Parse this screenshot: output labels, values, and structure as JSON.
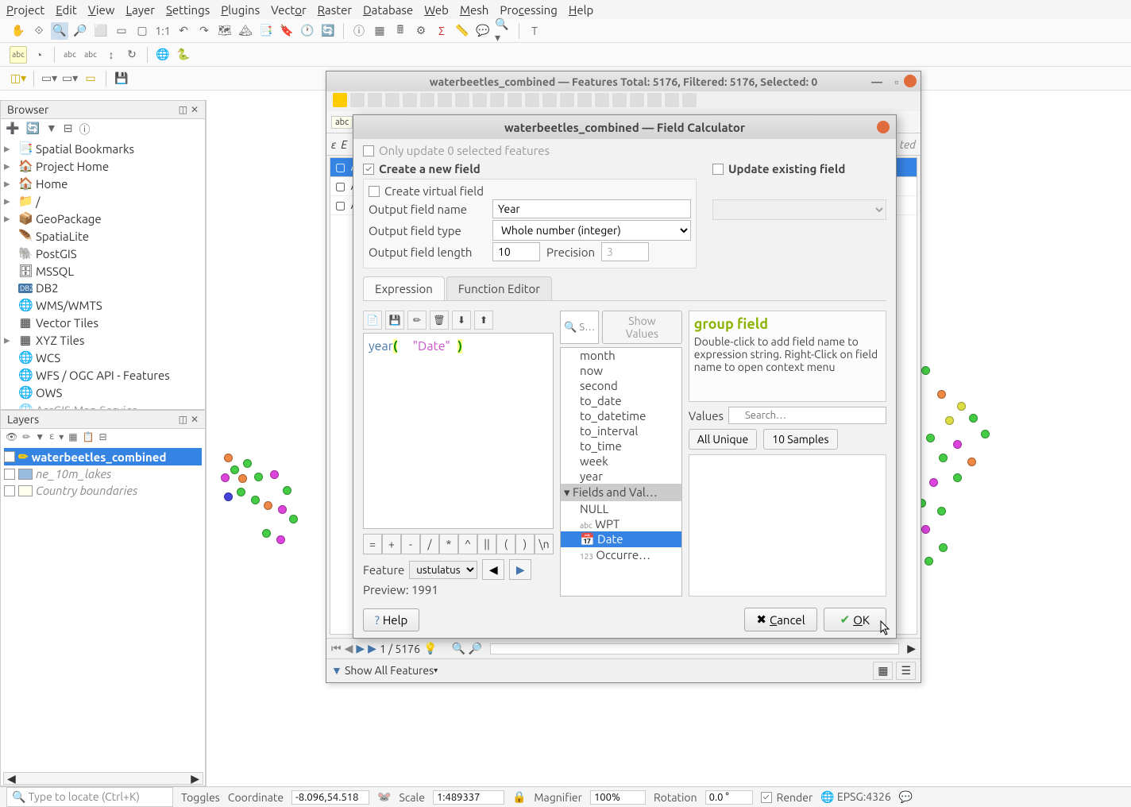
{
  "menubar": [
    "Project",
    "Edit",
    "View",
    "Layer",
    "Settings",
    "Plugins",
    "Vector",
    "Raster",
    "Database",
    "Web",
    "Mesh",
    "Processing",
    "Help"
  ],
  "browser": {
    "title": "Browser",
    "items": [
      "Spatial Bookmarks",
      "Project Home",
      "Home",
      "/",
      "GeoPackage",
      "SpatiaLite",
      "PostGIS",
      "MSSQL",
      "DB2",
      "WMS/WMTS",
      "Vector Tiles",
      "XYZ Tiles",
      "WCS",
      "WFS / OGC API - Features",
      "OWS",
      "ArcGIS Map Service"
    ]
  },
  "layers": {
    "title": "Layers",
    "items": [
      {
        "name": "waterbeetles_combined",
        "checked": true,
        "selected": true,
        "italic": false,
        "color": "#fc0"
      },
      {
        "name": "ne_10m_lakes",
        "checked": false,
        "selected": false,
        "italic": true,
        "color": "#9bd"
      },
      {
        "name": "Country boundaries",
        "checked": false,
        "selected": false,
        "italic": true,
        "color": "#ffe"
      }
    ]
  },
  "attr_window": {
    "title": "waterbeetles_combined — Features Total: 5176, Filtered: 5176, Selected: 0",
    "nav": "1 / 5176",
    "show": "Show All Features"
  },
  "fieldcalc": {
    "title": "waterbeetles_combined — Field Calculator",
    "only_selected": "Only update 0 selected features",
    "create_new": "Create a new field",
    "create_virtual": "Create virtual field",
    "update_existing": "Update existing field",
    "field_name_label": "Output field name",
    "field_name": "Year",
    "field_type_label": "Output field type",
    "field_type": "Whole number (integer)",
    "field_len_label": "Output field length",
    "field_len": "10",
    "precision_label": "Precision",
    "precision": "3",
    "tabs": [
      "Expression",
      "Function Editor"
    ],
    "expression_parts": {
      "func": "year",
      "paren_open": "(",
      "arg": "\"Date\"",
      "paren_close": ")"
    },
    "operators": [
      "=",
      "+",
      "-",
      "/",
      "*",
      "^",
      "||",
      "(",
      ")",
      "\\n"
    ],
    "feature_label": "Feature",
    "feature_value": "ustulatus",
    "preview_label": "Preview:",
    "preview_value": "1991",
    "search_placeholder": "S…",
    "show_values": "Show Values",
    "functions": [
      "month",
      "now",
      "second",
      "to_date",
      "to_datetime",
      "to_interval",
      "to_time",
      "week",
      "year"
    ],
    "group_label": "Fields and Val…",
    "fields": [
      {
        "label": "NULL",
        "prefix": ""
      },
      {
        "label": "WPT",
        "prefix": "abc"
      },
      {
        "label": "Date",
        "prefix": "📅",
        "selected": true
      },
      {
        "label": "Occurre…",
        "prefix": "123"
      }
    ],
    "help": {
      "title": "group field",
      "body": "Double-click to add field name to expression string. Right-Click on field name to open context menu"
    },
    "values_label": "Values",
    "values_search": "Search…",
    "all_unique": "All Unique",
    "ten_samples": "10 Samples",
    "help_btn": "Help",
    "cancel_btn": "Cancel",
    "ok_btn": "OK"
  },
  "status": {
    "locate_placeholder": "Type to locate (Ctrl+K)",
    "toggles": "Toggles",
    "coord_label": "Coordinate",
    "coord": "-8.096,54.518",
    "scale_label": "Scale",
    "scale": "1:489337",
    "magnifier_label": "Magnifier",
    "magnifier": "100%",
    "rotation_label": "Rotation",
    "rotation": "0.0 °",
    "render": "Render",
    "crs": "EPSG:4326"
  }
}
